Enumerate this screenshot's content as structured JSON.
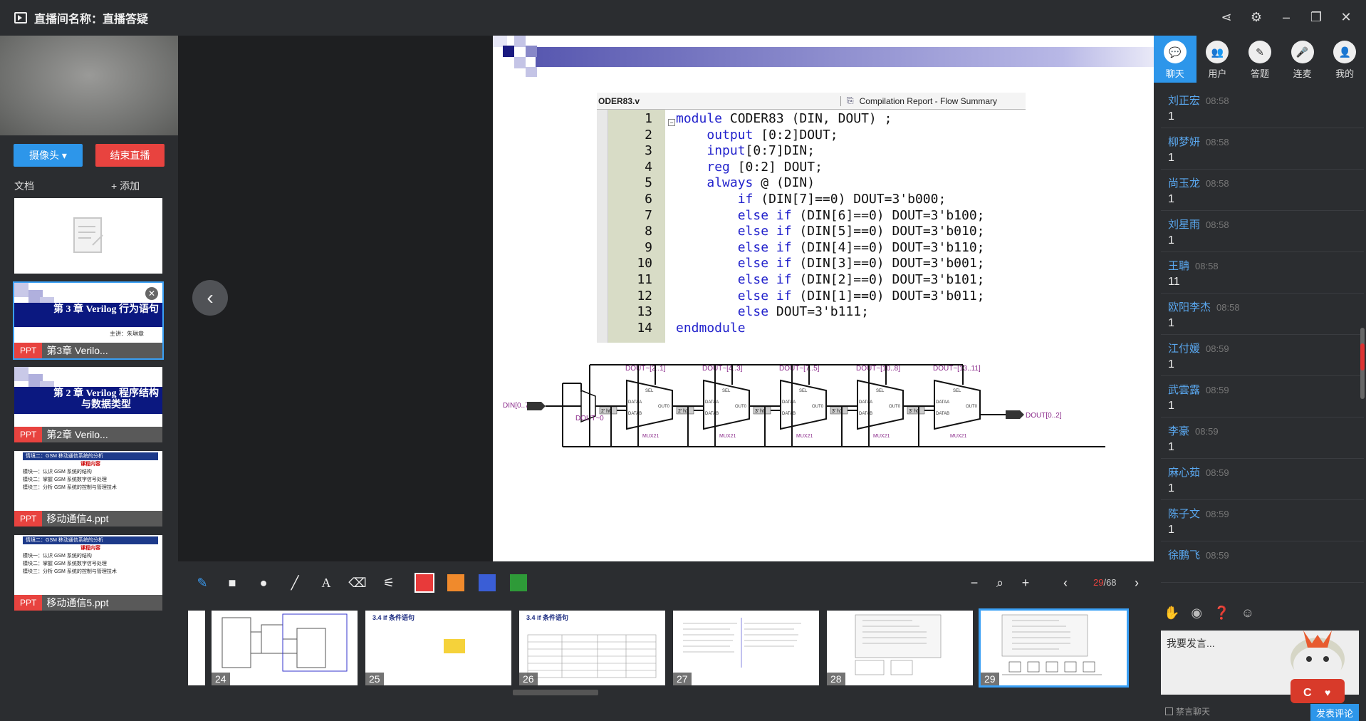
{
  "window": {
    "title": "直播间名称：直播答疑"
  },
  "left": {
    "camera_button": "摄像头 ▾",
    "end_button": "结束直播",
    "docs_label": "文档",
    "add_label": "+ 添加",
    "docs": [
      {
        "type": "",
        "name": "",
        "title": ""
      },
      {
        "type": "PPT",
        "name": "第3章 Verilo...",
        "title": "第 3 章  Verilog 行为语句",
        "subtitle": "主讲：朱琳章"
      },
      {
        "type": "PPT",
        "name": "第2章 Verilo...",
        "title": "第 2 章  Verilog 程序结构与数据类型"
      },
      {
        "type": "PPT",
        "name": "移动通信4.ppt",
        "header": "情境二：GSM 移动通信系统的分析",
        "heading": "课程内容",
        "lines": [
          "模块一：认识 GSM 系统的结构",
          "模块二：掌握 GSM 系统数字信号处理",
          "模块三：分析 GSM 系统的控制与管理技术"
        ]
      },
      {
        "type": "PPT",
        "name": "移动通信5.ppt",
        "header": "情境二：GSM 移动通信系统的分析",
        "heading": "课程内容",
        "lines": [
          "模块一：认识 GSM 系统的结构",
          "模块二：掌握 GSM 系统数字信号处理",
          "模块三：分析 GSM 系统的控制与管理技术"
        ]
      }
    ]
  },
  "slide": {
    "tab_file": "ODER83.v",
    "tab_report": "Compilation Report - Flow Summary",
    "line_numbers": [
      "1",
      "2",
      "3",
      "4",
      "5",
      "6",
      "7",
      "8",
      "9",
      "10",
      "11",
      "12",
      "13",
      "14"
    ],
    "code_lines": [
      "module CODER83 (DIN, DOUT) ;",
      "    output [0:2]DOUT;",
      "    input[0:7]DIN;",
      "    reg [0:2] DOUT;",
      "    always @ (DIN)",
      "        if (DIN[7]==0) DOUT=3'b000;",
      "        else if (DIN[6]==0) DOUT=3'b100;",
      "        else if (DIN[5]==0) DOUT=3'b010;",
      "        else if (DIN[4]==0) DOUT=3'b110;",
      "        else if (DIN[3]==0) DOUT=3'b001;",
      "        else if (DIN[2]==0) DOUT=3'b101;",
      "        else if (DIN[1]==0) DOUT=3'b011;",
      "        else DOUT=3'b111;",
      "endmodule"
    ],
    "circuit": {
      "input_label": "DIN[0..7]",
      "output_label": "DOUT[0..2]",
      "first_label": "DOUT~0",
      "mux_labels": [
        "DOUT~[2..1]",
        "DOUT~[4..3]",
        "DOUT~[7..5]",
        "DOUT~[10..8]",
        "DOUT~[13..11]"
      ],
      "mux_name": "MUX21",
      "pins": [
        "SEL",
        "DATAA",
        "DATAB",
        "OUT0"
      ],
      "consts": [
        "2' h0",
        "2' h3",
        "3' h0",
        "3' h1",
        "3' h0"
      ]
    }
  },
  "toolbar": {
    "page_current": "29",
    "page_total": "/68",
    "colors": [
      "#e83a3a",
      "#f08a2c",
      "#3a5ed6",
      "#2e9a38"
    ]
  },
  "strip": [
    {
      "num": "24",
      "head": ""
    },
    {
      "num": "25",
      "head": "3.4  if 条件语句"
    },
    {
      "num": "26",
      "head": "3.4  if 条件语句"
    },
    {
      "num": "27",
      "head": ""
    },
    {
      "num": "28",
      "head": ""
    },
    {
      "num": "29",
      "head": ""
    }
  ],
  "right": {
    "tabs": [
      "聊天",
      "用户",
      "答题",
      "连麦",
      "我的"
    ],
    "messages": [
      {
        "name": "刘正宏",
        "time": "08:58",
        "text": "1"
      },
      {
        "name": "柳梦妍",
        "time": "08:58",
        "text": "1"
      },
      {
        "name": "尚玉龙",
        "time": "08:58",
        "text": "1"
      },
      {
        "name": "刘星雨",
        "time": "08:58",
        "text": "1"
      },
      {
        "name": "王聃",
        "time": "08:58",
        "text": "11"
      },
      {
        "name": "欧阳李杰",
        "time": "08:58",
        "text": "1"
      },
      {
        "name": "江付媛",
        "time": "08:59",
        "text": "1"
      },
      {
        "name": "武雲露",
        "time": "08:59",
        "text": "1"
      },
      {
        "name": "李豪",
        "time": "08:59",
        "text": "1"
      },
      {
        "name": "麻心茹",
        "time": "08:59",
        "text": "1"
      },
      {
        "name": "陈子文",
        "time": "08:59",
        "text": "1"
      },
      {
        "name": "徐鹏飞",
        "time": "08:59",
        "text": ""
      }
    ],
    "input_placeholder": "我要发言...",
    "mute_label": "禁言聊天",
    "send_label": "发表评论"
  }
}
